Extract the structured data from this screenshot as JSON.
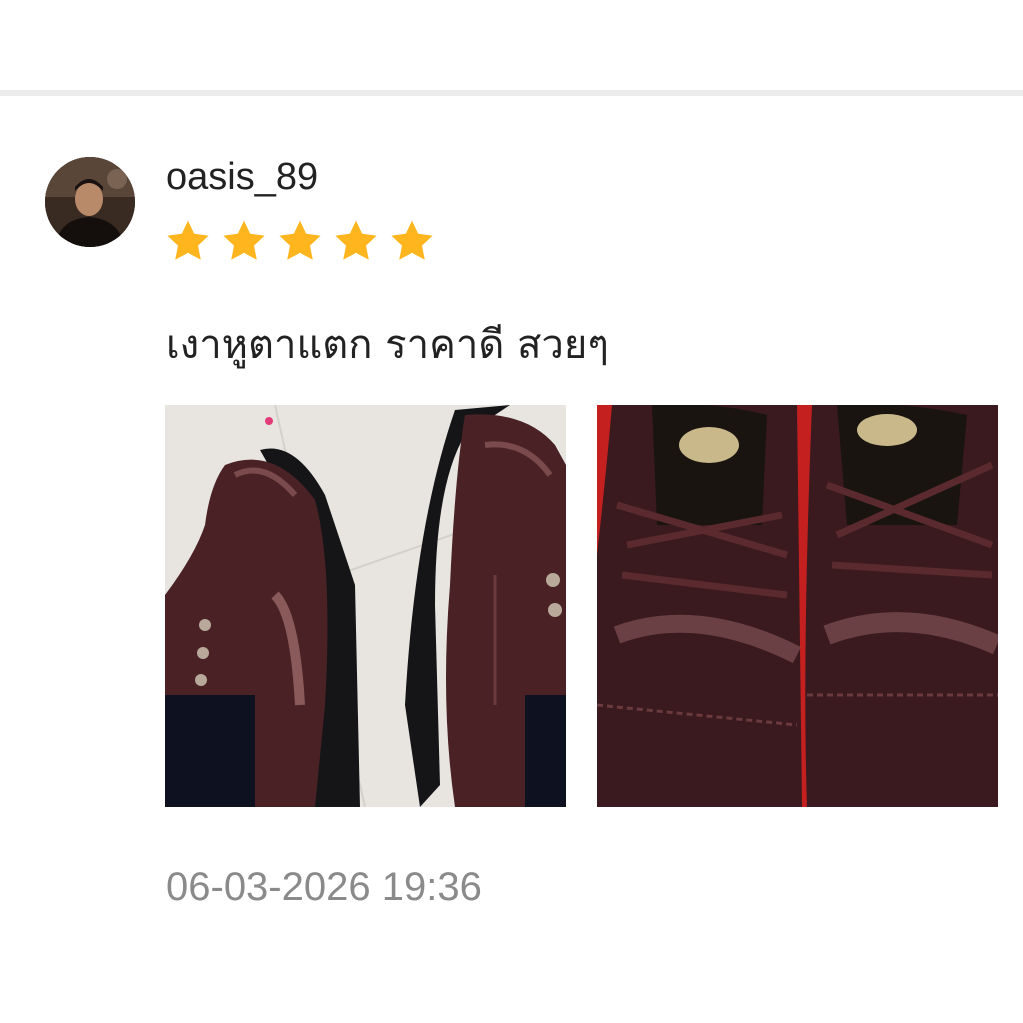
{
  "review": {
    "username": "oasis_89",
    "rating": 5,
    "rating_max": 5,
    "text": "เงาหูตาแตก ราคาดี สวยๆ",
    "timestamp": "06-03-2026 19:36"
  },
  "colors": {
    "star": "#FFB51E",
    "username": "#222222",
    "timestamp": "#8A8A8A",
    "divider": "#ECECEC"
  },
  "icons": {
    "star": "star-icon"
  }
}
